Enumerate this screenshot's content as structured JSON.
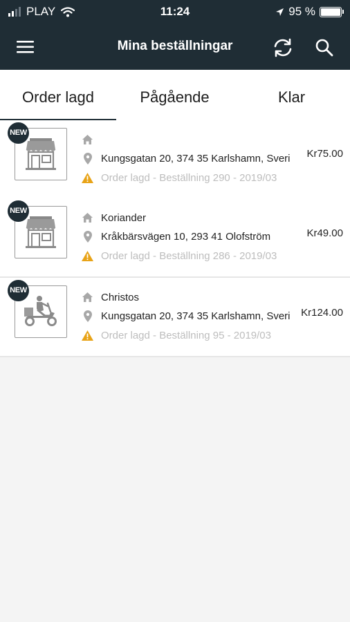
{
  "status_bar": {
    "carrier": "PLAY",
    "time": "11:24",
    "battery": "95 %",
    "battery_level": 0.95
  },
  "header": {
    "title": "Mina beställningar",
    "menu_icon": "hamburger-menu-icon",
    "refresh_icon": "refresh-icon",
    "search_icon": "search-icon"
  },
  "tabs": [
    {
      "label": "Order lagd",
      "active": true
    },
    {
      "label": "Pågående",
      "active": false
    },
    {
      "label": "Klar",
      "active": false
    }
  ],
  "orders": [
    {
      "badge": "NEW",
      "thumb_icon": "storefront-icon",
      "restaurant": "",
      "address": "Kungsgatan 20, 374 35 Karlshamn, Sverige",
      "status": "Order lagd - Beställning 290 - 2019/03",
      "price": "Kr75.00"
    },
    {
      "badge": "NEW",
      "thumb_icon": "storefront-icon",
      "restaurant": "Koriander",
      "address": "Kråkbärsvägen 10, 293 41 Olofström",
      "status": "Order lagd - Beställning 286 - 2019/03",
      "price": "Kr49.00"
    },
    {
      "badge": "NEW",
      "thumb_icon": "delivery-scooter-icon",
      "restaurant": "Christos",
      "address": "Kungsgatan 20, 374 35 Karlshamn, Sverige",
      "status": "Order lagd - Beställning 95 - 2019/03",
      "price": "Kr124.00"
    }
  ],
  "colors": {
    "header_bg": "#1f2d35",
    "warning": "#e8a317",
    "muted_text": "#bdbdbd"
  }
}
